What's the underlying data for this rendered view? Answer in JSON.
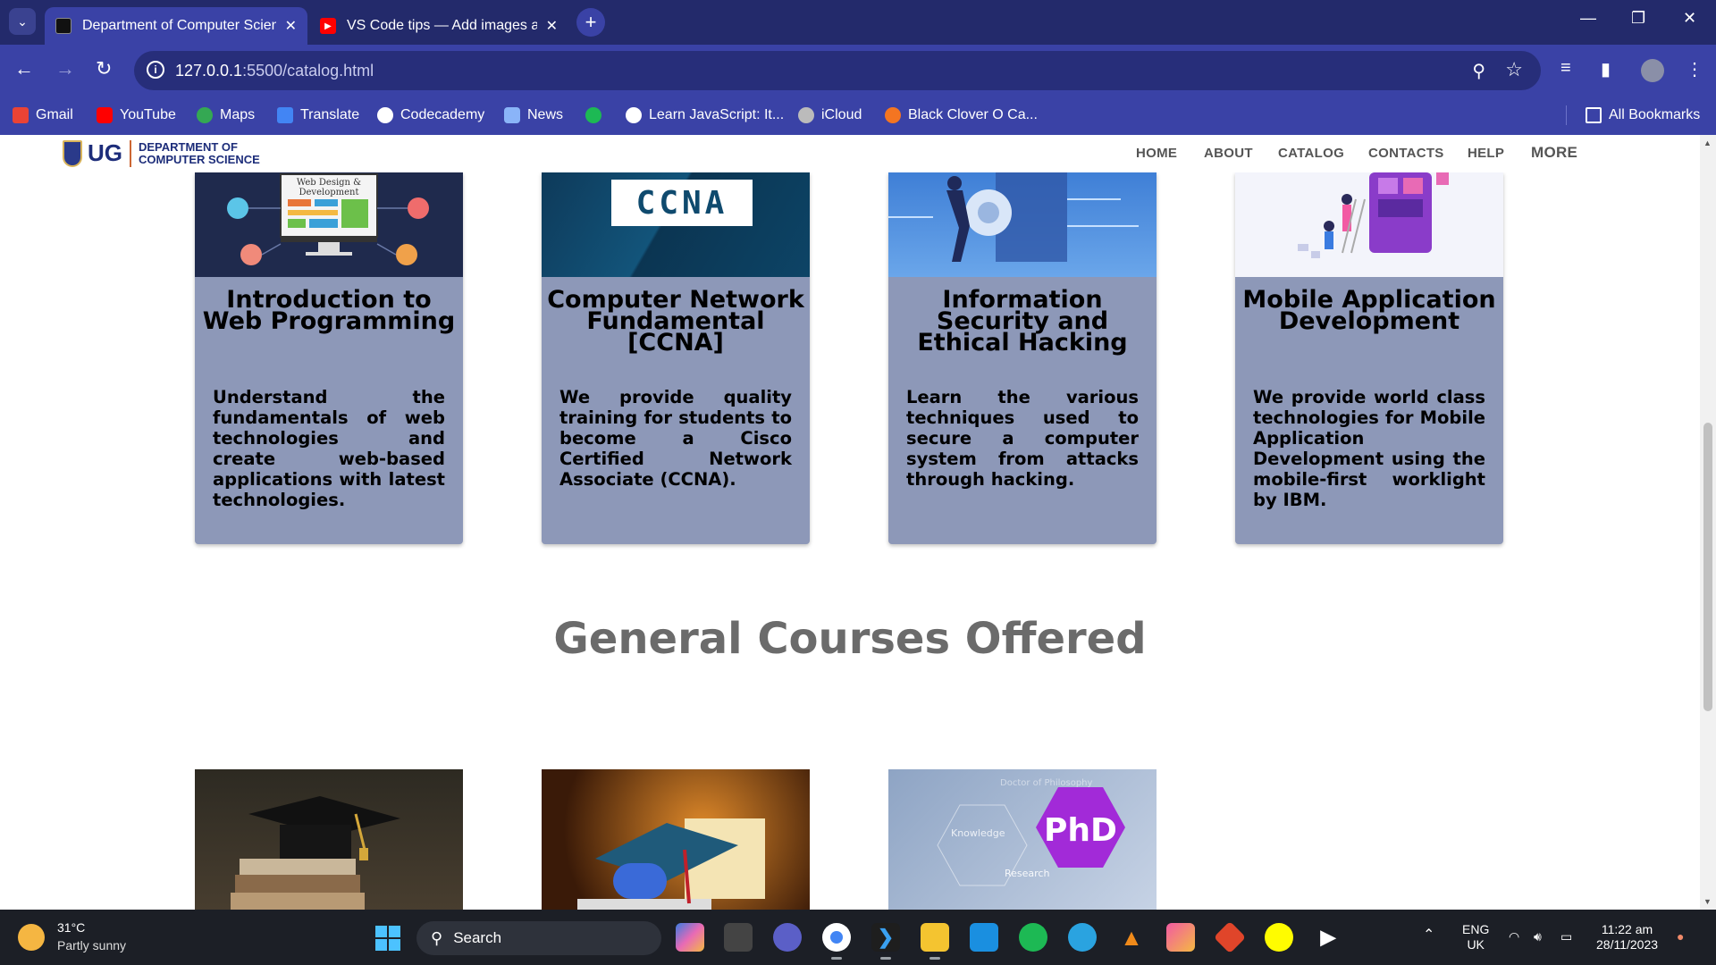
{
  "browser": {
    "tabs": [
      {
        "title": "Department of Computer Scien",
        "active": true
      },
      {
        "title": "VS Code tips — Add images an",
        "active": false
      }
    ],
    "url_host": "127.0.0.1",
    "url_path": ":5500/catalog.html",
    "bookmarks": [
      {
        "label": "Gmail"
      },
      {
        "label": "YouTube"
      },
      {
        "label": "Maps"
      },
      {
        "label": "Translate"
      },
      {
        "label": "Codecademy"
      },
      {
        "label": "News"
      },
      {
        "label": ""
      },
      {
        "label": "Learn JavaScript: It..."
      },
      {
        "label": "iCloud"
      },
      {
        "label": "Black Clover O Ca..."
      }
    ],
    "all_bookmarks": "All Bookmarks"
  },
  "site": {
    "logo_ug": "UG",
    "logo_dept_line1": "DEPARTMENT OF",
    "logo_dept_line2": "COMPUTER SCIENCE",
    "nav": [
      "HOME",
      "ABOUT",
      "CATALOG",
      "CONTACTS",
      "HELP",
      "MORE"
    ]
  },
  "courses": [
    {
      "title": "Introduction to Web Programming",
      "description": "Understand the fundamentals of web technologies and create web-based applications with latest technologies.",
      "image_text": "Web Design & Development"
    },
    {
      "title": "Computer Network Fundamental [CCNA]",
      "description": "We provide quality training for students to become a Cisco Certified Network Associate (CCNA).",
      "image_text": "CCNA"
    },
    {
      "title": "Information Security and Ethical Hacking",
      "description": "Learn the various techniques used to secure a computer system from attacks through hacking."
    },
    {
      "title": "Mobile Application Development",
      "description": "We provide world class technologies for Mobile Application Development using the mobile-first worklight by IBM."
    }
  ],
  "general_section_title": "General Courses Offered",
  "general_courses_images": [
    {
      "image": "graduation-cap-on-books"
    },
    {
      "image": "graduation-cap-on-stack"
    },
    {
      "image": "phd-hexagon",
      "labels": [
        "Doctor of Philosophy",
        "Knowledge",
        "PhD",
        "Research"
      ]
    }
  ],
  "taskbar": {
    "temp": "31°C",
    "weather": "Partly sunny",
    "search": "Search",
    "lang_line1": "ENG",
    "lang_line2": "UK",
    "time": "11:22 am",
    "date": "28/11/2023"
  },
  "colors": {
    "tabstrip": "#232a6b",
    "toolbar": "#3a42a6",
    "card_bg": "#8d98b8",
    "section_title": "#6b6b6b",
    "taskbar": "#1c1f26"
  }
}
